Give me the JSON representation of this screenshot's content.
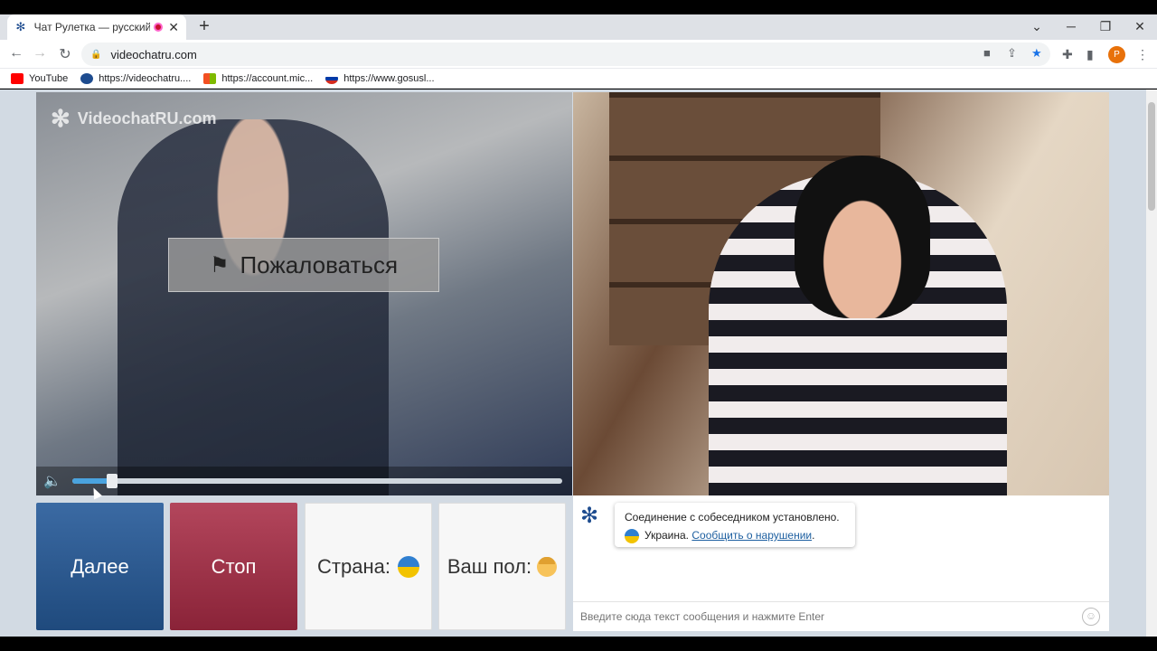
{
  "browser": {
    "tab_title": "Чат Рулетка — русский вид",
    "url": "videochatru.com",
    "profile_initial": "P",
    "bookmarks": [
      {
        "label": "YouTube",
        "color": "#ff0000"
      },
      {
        "label": "https://videochatru....",
        "color": "#1e4c8f"
      },
      {
        "label": "https://account.mic...",
        "color": "#f25022"
      },
      {
        "label": "https://www.gosusl...",
        "color": "#d52b1e"
      }
    ]
  },
  "video": {
    "watermark": "VideochatRU.com",
    "report_label": "Пожаловаться",
    "volume_level": 0.07
  },
  "controls": {
    "next_label": "Далее",
    "stop_label": "Стоп",
    "country_label": "Страна:",
    "sex_label": "Ваш пол:"
  },
  "chat": {
    "message_line1": "Соединение с собеседником установлено.",
    "country_name": "Украина.",
    "report_link": "Сообщить о нарушении",
    "period": ".",
    "input_placeholder": "Введите сюда текст сообщения и нажмите Enter"
  }
}
